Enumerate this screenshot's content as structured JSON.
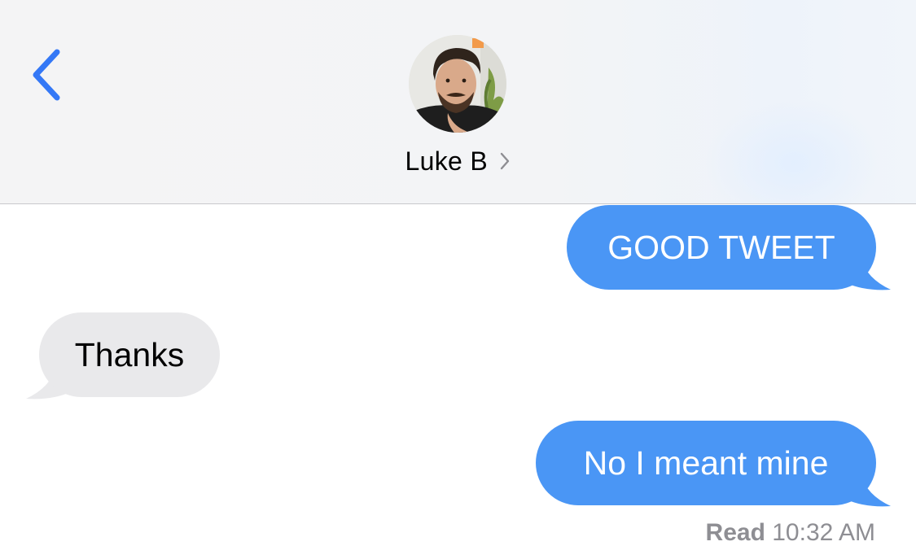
{
  "header": {
    "back_icon": "chevron-left-icon",
    "contact_name": "Luke B",
    "detail_icon": "chevron-right-icon",
    "avatar_icon": "contact-avatar-photo"
  },
  "messages": [
    {
      "direction": "sent",
      "text": "GOOD TWEET"
    },
    {
      "direction": "received",
      "text": "Thanks"
    },
    {
      "direction": "sent",
      "text": "No I meant mine"
    }
  ],
  "receipt": {
    "label": "Read",
    "time": "10:32 AM"
  },
  "colors": {
    "accent": "#3478f6",
    "sent_bubble": "#4a96f5",
    "received_bubble": "#e9e9eb",
    "receipt_text": "#8e8e93"
  }
}
